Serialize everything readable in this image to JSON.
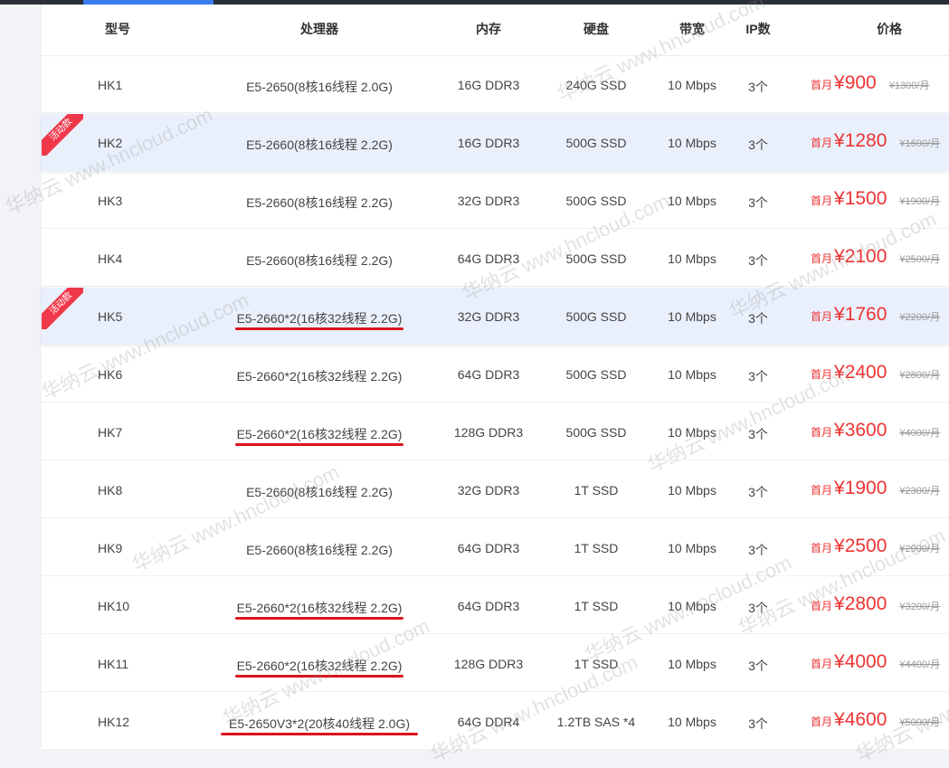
{
  "header": {
    "model": "型号",
    "cpu": "处理器",
    "ram": "内存",
    "disk": "硬盘",
    "bandwidth": "带宽",
    "ips": "IP数",
    "price": "价格"
  },
  "badge_label": "活动款",
  "price_prefix": "首月",
  "watermark_text": "华纳云 www.hncloud.com",
  "rows": [
    {
      "model": "HK1",
      "cpu": "E5-2650(8核16线程 2.0G)",
      "ram": "16G DDR3",
      "disk": "240G SSD",
      "bandwidth": "10 Mbps",
      "ips": "3个",
      "price": "¥900",
      "old_price": "¥1300/月",
      "featured": false,
      "cpu_underlined": false
    },
    {
      "model": "HK2",
      "cpu": "E5-2660(8核16线程 2.2G)",
      "ram": "16G DDR3",
      "disk": "500G SSD",
      "bandwidth": "10 Mbps",
      "ips": "3个",
      "price": "¥1280",
      "old_price": "¥1600/月",
      "featured": true,
      "cpu_underlined": false
    },
    {
      "model": "HK3",
      "cpu": "E5-2660(8核16线程 2.2G)",
      "ram": "32G DDR3",
      "disk": "500G SSD",
      "bandwidth": "10 Mbps",
      "ips": "3个",
      "price": "¥1500",
      "old_price": "¥1900/月",
      "featured": false,
      "cpu_underlined": false
    },
    {
      "model": "HK4",
      "cpu": "E5-2660(8核16线程 2.2G)",
      "ram": "64G DDR3",
      "disk": "500G SSD",
      "bandwidth": "10 Mbps",
      "ips": "3个",
      "price": "¥2100",
      "old_price": "¥2500/月",
      "featured": false,
      "cpu_underlined": false
    },
    {
      "model": "HK5",
      "cpu": "E5-2660*2(16核32线程 2.2G)",
      "ram": "32G DDR3",
      "disk": "500G SSD",
      "bandwidth": "10 Mbps",
      "ips": "3个",
      "price": "¥1760",
      "old_price": "¥2200/月",
      "featured": true,
      "cpu_underlined": true
    },
    {
      "model": "HK6",
      "cpu": "E5-2660*2(16核32线程 2.2G)",
      "ram": "64G DDR3",
      "disk": "500G SSD",
      "bandwidth": "10 Mbps",
      "ips": "3个",
      "price": "¥2400",
      "old_price": "¥2800/月",
      "featured": false,
      "cpu_underlined": false
    },
    {
      "model": "HK7",
      "cpu": "E5-2660*2(16核32线程 2.2G)",
      "ram": "128G DDR3",
      "disk": "500G SSD",
      "bandwidth": "10 Mbps",
      "ips": "3个",
      "price": "¥3600",
      "old_price": "¥4000/月",
      "featured": false,
      "cpu_underlined": true
    },
    {
      "model": "HK8",
      "cpu": "E5-2660(8核16线程 2.2G)",
      "ram": "32G DDR3",
      "disk": "1T SSD",
      "bandwidth": "10 Mbps",
      "ips": "3个",
      "price": "¥1900",
      "old_price": "¥2300/月",
      "featured": false,
      "cpu_underlined": false
    },
    {
      "model": "HK9",
      "cpu": "E5-2660(8核16线程 2.2G)",
      "ram": "64G DDR3",
      "disk": "1T SSD",
      "bandwidth": "10 Mbps",
      "ips": "3个",
      "price": "¥2500",
      "old_price": "¥2900/月",
      "featured": false,
      "cpu_underlined": false
    },
    {
      "model": "HK10",
      "cpu": "E5-2660*2(16核32线程 2.2G)",
      "ram": "64G DDR3",
      "disk": "1T SSD",
      "bandwidth": "10 Mbps",
      "ips": "3个",
      "price": "¥2800",
      "old_price": "¥3200/月",
      "featured": false,
      "cpu_underlined": true
    },
    {
      "model": "HK11",
      "cpu": "E5-2660*2(16核32线程 2.2G)",
      "ram": "128G DDR3",
      "disk": "1T SSD",
      "bandwidth": "10 Mbps",
      "ips": "3个",
      "price": "¥4000",
      "old_price": "¥4400/月",
      "featured": false,
      "cpu_underlined": true
    },
    {
      "model": "HK12",
      "cpu": "E5-2650V3*2(20核40线程 2.0G)",
      "ram": "64G DDR4",
      "disk": "1.2TB SAS *4",
      "bandwidth": "10 Mbps",
      "ips": "3个",
      "price": "¥4600",
      "old_price": "¥5000/月",
      "featured": false,
      "cpu_underlined": true
    }
  ]
}
